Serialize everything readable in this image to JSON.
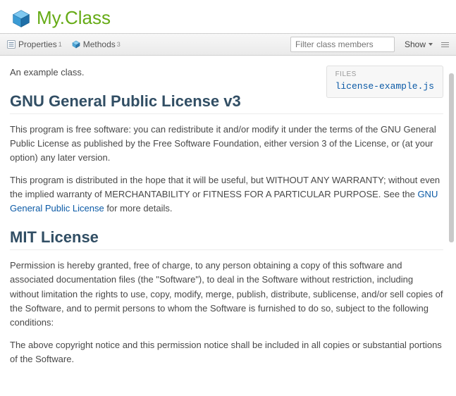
{
  "header": {
    "class_name": "My.Class"
  },
  "toolbar": {
    "properties_label": "Properties",
    "properties_count": "1",
    "methods_label": "Methods",
    "methods_count": "3",
    "filter_placeholder": "Filter class members",
    "show_label": "Show"
  },
  "files_box": {
    "title": "FILES",
    "file": "license-example.js"
  },
  "intro": "An example class.",
  "sections": {
    "gnu": {
      "title": "GNU General Public License v3",
      "p1": "This program is free software: you can redistribute it and/or modify it under the terms of the GNU General Public License as published by the Free Software Foundation, either version 3 of the License, or (at your option) any later version.",
      "p2a": "This program is distributed in the hope that it will be useful, but WITHOUT ANY WARRANTY; without even the implied warranty of MERCHANTABILITY or FITNESS FOR A PARTICULAR PURPOSE. See the ",
      "p2_link": "GNU General Public License",
      "p2b": " for more details."
    },
    "mit": {
      "title": "MIT License",
      "p1": "Permission is hereby granted, free of charge, to any person obtaining a copy of this software and associated documentation files (the \"Software\"), to deal in the Software without restriction, including without limitation the rights to use, copy, modify, merge, publish, distribute, sublicense, and/or sell copies of the Software, and to permit persons to whom the Software is furnished to do so, subject to the following conditions:",
      "p2": "The above copyright notice and this permission notice shall be included in all copies or substantial portions of the Software."
    }
  }
}
